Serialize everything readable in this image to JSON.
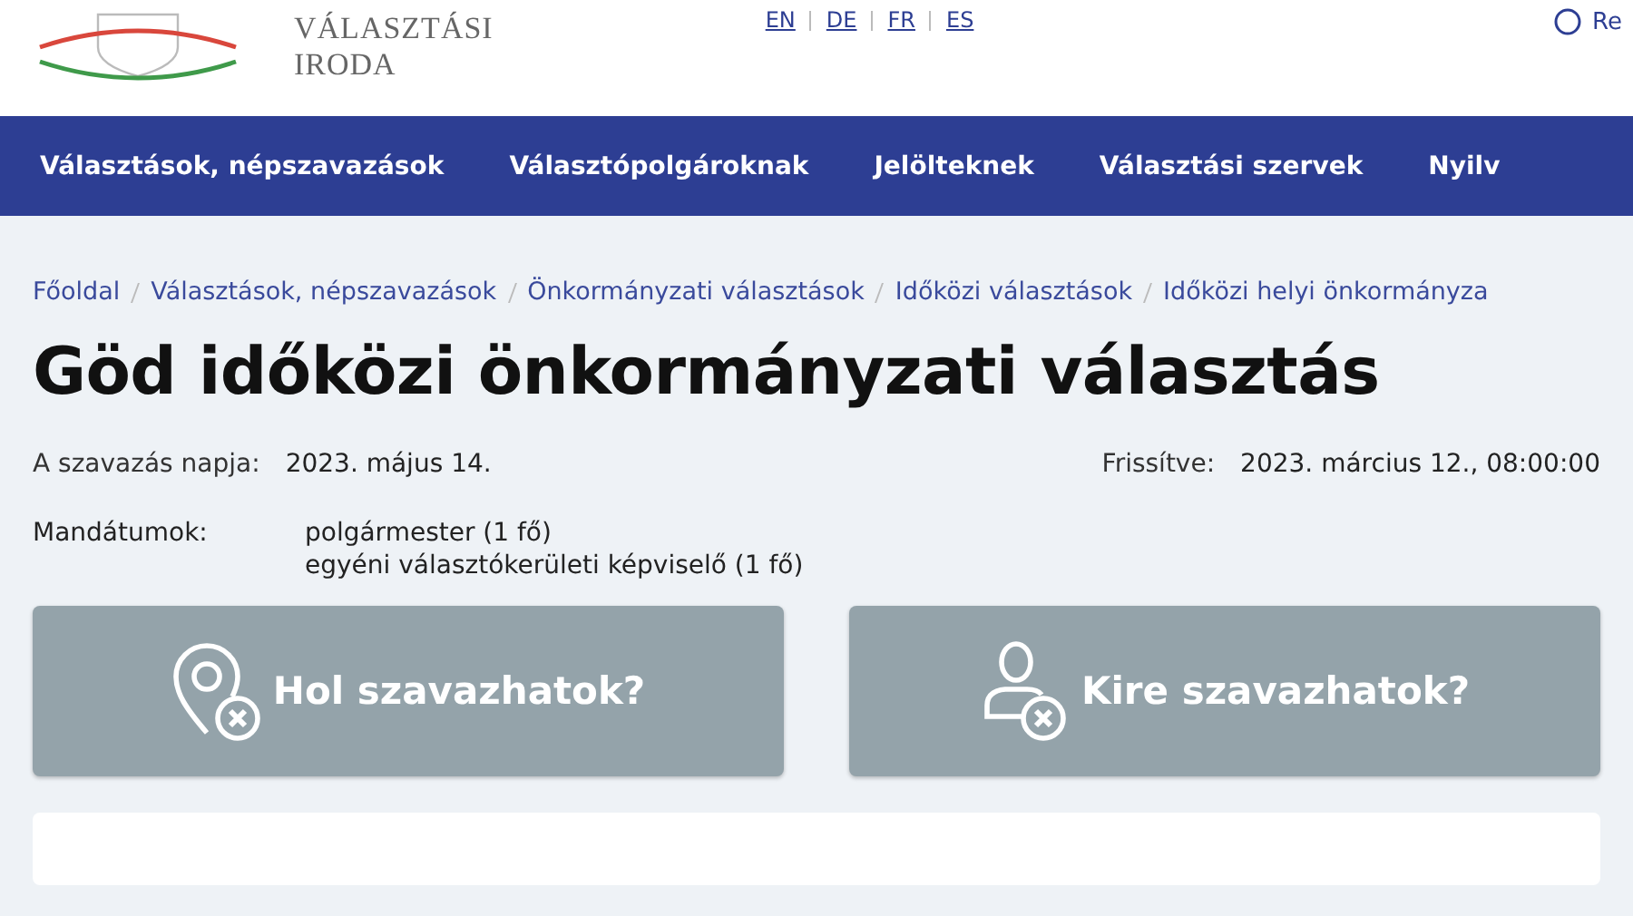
{
  "header": {
    "logo_lines": [
      "VÁLASZTÁSI",
      "IRODA"
    ],
    "languages": [
      {
        "label": "EN"
      },
      {
        "label": "DE"
      },
      {
        "label": "FR"
      },
      {
        "label": "ES"
      }
    ],
    "right_link": "Re"
  },
  "nav": [
    {
      "label": "Választások, népszavazások"
    },
    {
      "label": "Választópolgároknak"
    },
    {
      "label": "Jelölteknek"
    },
    {
      "label": "Választási szervek"
    },
    {
      "label": "Nyilv"
    }
  ],
  "breadcrumb": [
    "Főoldal",
    "Választások, népszavazások",
    "Önkormányzati választások",
    "Időközi választások",
    "Időközi helyi önkormányza"
  ],
  "title": "Göd időközi önkormányzati választás",
  "voting_day": {
    "label": "A szavazás napja:",
    "value": "2023. május 14."
  },
  "updated": {
    "label": "Frissítve:",
    "value": "2023. március 12., 08:00:00"
  },
  "mandates": {
    "label": "Mandátumok:",
    "items": [
      "polgármester (1 fő)",
      "egyéni választókerületi képviselő (1 fő)"
    ]
  },
  "actions": [
    {
      "kind": "location",
      "label": "Hol szavazhatok?"
    },
    {
      "kind": "person",
      "label": "Kire szavazhatok?"
    }
  ]
}
